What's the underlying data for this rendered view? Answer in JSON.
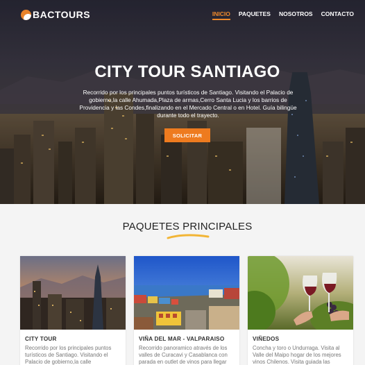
{
  "brand": {
    "name": "BACTOURS"
  },
  "nav": {
    "items": [
      "INICIO",
      "PAQUETES",
      "NOSOTROS",
      "CONTACTO"
    ],
    "active": "INICIO"
  },
  "hero": {
    "title": "CITY TOUR SANTIAGO",
    "text": "Recorrido por los principales puntos turísticos de Santiago. Visitando el Palacio de gobierno,la calle Ahumada,Plaza de armas,Cerro Santa Lucia y los barrios de Providencia y las Condes,finalizando en el Mercado Central o en Hotel. Guía bilingüe durante todo el trayecto.",
    "button": "SOLICITAR"
  },
  "packages": {
    "title": "PAQUETES PRINCIPALES",
    "cards": [
      {
        "title": "CITY TOUR",
        "desc": "Recorrido por los principales puntos turísticos de Santiago. Visitando el Palacio de gobierno,la calle"
      },
      {
        "title": "VIÑA DEL MAR - VALPARAISO",
        "desc": "Recorrido panoramico através de los valles de Curacavi y Casablanca con parada en outlet de vinos para llegar"
      },
      {
        "title": "VIÑEDOS",
        "desc": "Concha y toro o Undurraga. Visita al Valle del Maipo hogar de los mejores vinos Chilenos. Visita guiada las instalaciones"
      }
    ]
  },
  "colors": {
    "accent": "#ee7b1f",
    "nav_active": "#f08a2c"
  }
}
